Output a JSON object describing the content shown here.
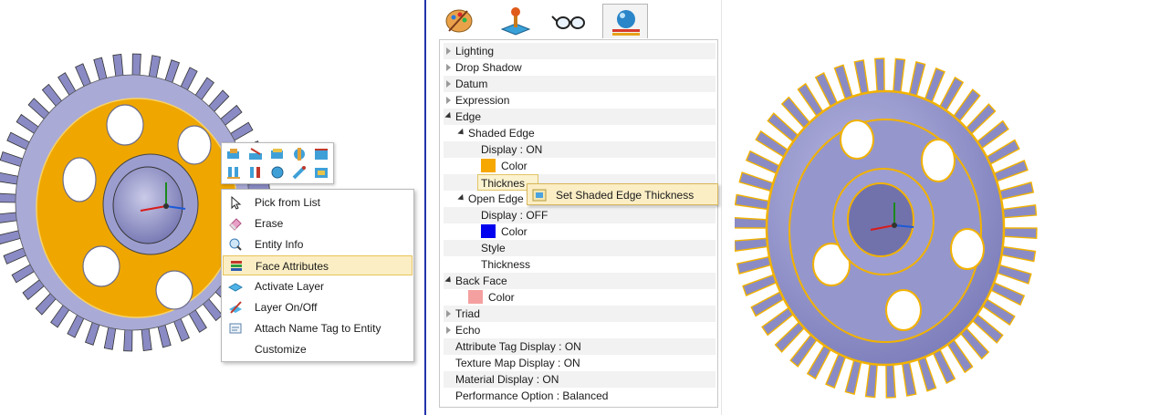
{
  "context_menu": {
    "items": [
      {
        "label": "Pick from List",
        "icon": "cursor-icon"
      },
      {
        "label": "Erase",
        "icon": "eraser-icon"
      },
      {
        "label": "Entity Info",
        "icon": "info-icon"
      },
      {
        "label": "Face Attributes",
        "icon": "face-attributes-icon",
        "highlighted": true
      },
      {
        "label": "Activate Layer",
        "icon": "layer-icon"
      },
      {
        "label": "Layer On/Off",
        "icon": "layer-toggle-icon"
      },
      {
        "label": "Attach Name Tag to Entity",
        "icon": "name-tag-icon"
      },
      {
        "label": "Customize",
        "icon": ""
      }
    ]
  },
  "context_toolbar": {
    "icons": [
      "view-icon-1",
      "view-icon-2",
      "view-icon-3",
      "view-icon-4",
      "view-icon-5",
      "view-icon-6",
      "view-icon-7",
      "view-icon-8",
      "view-icon-9",
      "view-icon-10"
    ]
  },
  "tabs": [
    {
      "name": "palette-tab-icon",
      "active": false
    },
    {
      "name": "joystick-tab-icon",
      "active": false
    },
    {
      "name": "glasses-tab-icon",
      "active": false
    },
    {
      "name": "sphere-tab-icon",
      "active": true
    }
  ],
  "tree": {
    "lighting": "Lighting",
    "drop_shadow": "Drop Shadow",
    "datum": "Datum",
    "expression": "Expression",
    "edge": "Edge",
    "shaded_edge": "Shaded Edge",
    "shaded_display": "Display : ON",
    "shaded_color": "Color",
    "shaded_color_hex": "#f6a800",
    "shaded_thickness": "Thicknes",
    "open_edge": "Open Edge",
    "open_display": "Display : OFF",
    "open_color": "Color",
    "open_color_hex": "#0000ee",
    "open_style": "Style",
    "open_thickness": "Thickness",
    "back_face": "Back Face",
    "back_color": "Color",
    "back_color_hex": "#f4a0a0",
    "triad": "Triad",
    "echo": "Echo",
    "attr_tag": "Attribute Tag Display : ON",
    "texture_map": "Texture Map Display : ON",
    "material": "Material Display : ON",
    "performance": "Performance Option : Balanced"
  },
  "submenu": {
    "label": "Set Shaded Edge Thickness"
  },
  "colors": {
    "gear_body": "#8e8fc7",
    "gear_face_highlight": "#f0a800",
    "gear_edge": "#f2b200",
    "divider": "#2233aa"
  }
}
